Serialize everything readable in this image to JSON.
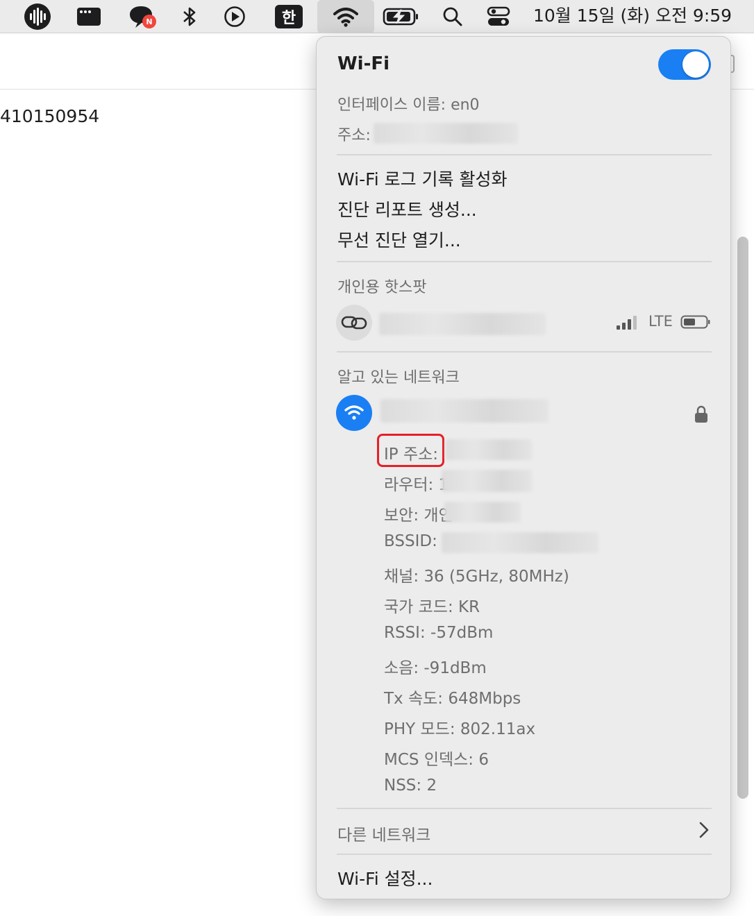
{
  "menubar": {
    "clock": "10월 15일 (화) 오전 9:59",
    "input_method": "한",
    "chat_badge": "N",
    "icons": [
      "voice-memo-icon",
      "window-icon",
      "chat-icon",
      "bluetooth-icon",
      "play-icon",
      "input-method-icon",
      "wifi-icon",
      "battery-charging-icon",
      "search-icon",
      "control-center-icon"
    ]
  },
  "background": {
    "number_text": "410150954"
  },
  "panel": {
    "title": "Wi-Fi",
    "toggle_on": true,
    "interface_label": "인터페이스 이름: en0",
    "address_label": "주소:",
    "menu": {
      "log_enable": "Wi-Fi 로그 기록 활성화",
      "diagnostic_report": "진단 리포트 생성...",
      "wireless_diagnostics": "무선 진단 열기..."
    },
    "hotspot": {
      "section": "개인용 핫스팟",
      "signal": "LTE"
    },
    "known": {
      "section": "알고 있는 네트워크",
      "details": {
        "ip": "IP 주소:",
        "router": "라우터: 1",
        "security": "보안: 개인",
        "bssid": "BSSID:",
        "channel": "채널: 36 (5GHz, 80MHz)",
        "country": "국가 코드: KR",
        "rssi": "RSSI: -57dBm",
        "noise": "소음: -91dBm",
        "tx": "Tx 속도: 648Mbps",
        "phy": "PHY 모드: 802.11ax",
        "mcs": "MCS 인덱스: 6",
        "nss": "NSS: 2"
      }
    },
    "other_networks": "다른 네트워크",
    "settings": "Wi-Fi 설정...",
    "colors": {
      "accent": "#1a7ff3",
      "highlight": "#e5202a"
    }
  }
}
